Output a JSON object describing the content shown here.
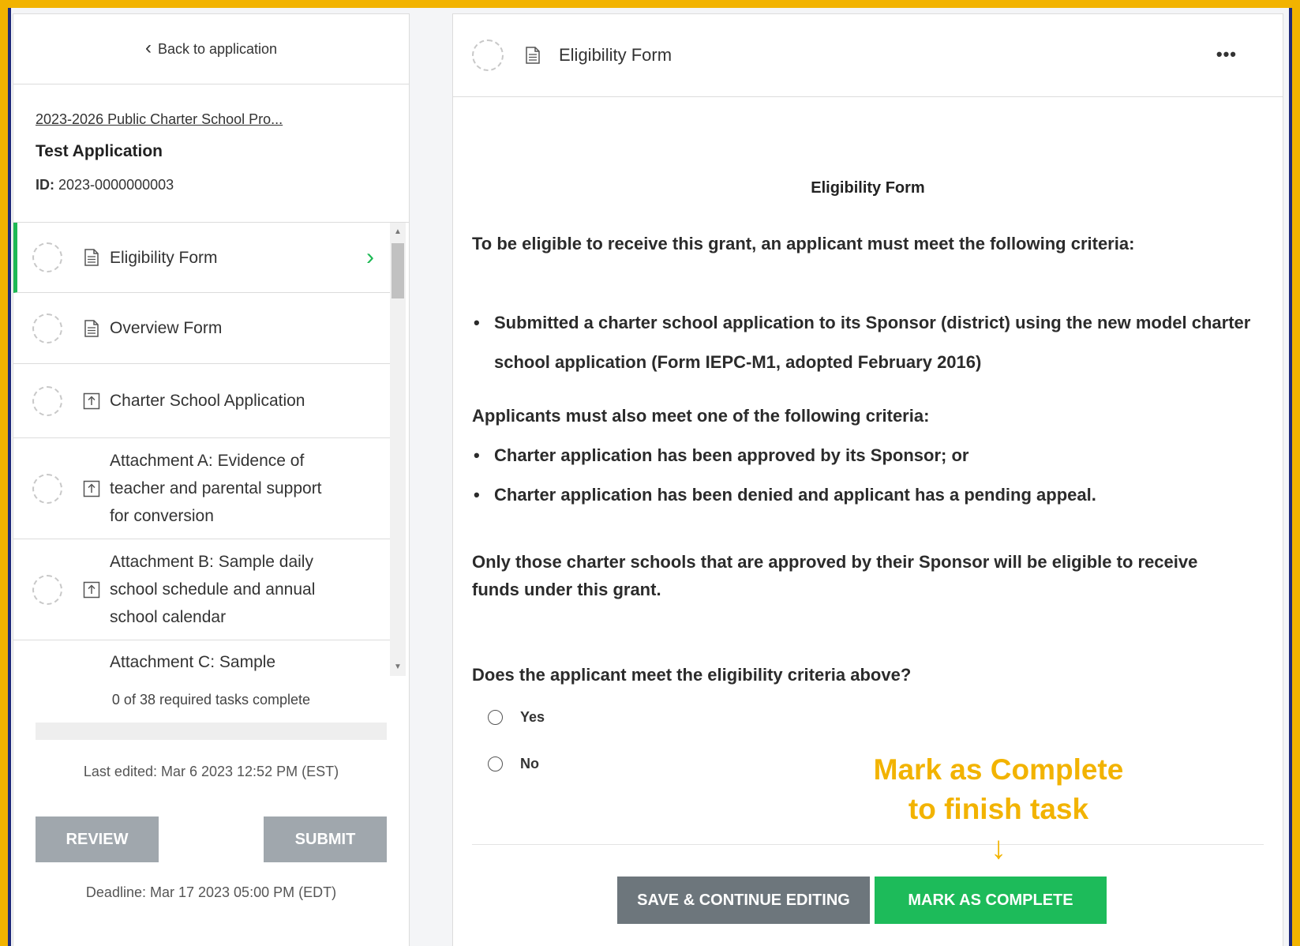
{
  "sidebar": {
    "back_label": "Back to application",
    "program_link": "2023-2026 Public Charter School Pro...",
    "application_title": "Test Application",
    "id_label": "ID:",
    "id_value": "2023-0000000003",
    "tasks": [
      {
        "label": "Eligibility Form",
        "icon": "document-icon",
        "active": true
      },
      {
        "label": "Overview Form",
        "icon": "document-icon",
        "active": false
      },
      {
        "label": "Charter School Application",
        "icon": "upload-icon",
        "active": false
      },
      {
        "label": "Attachment A: Evidence of teacher and parental support for conversion",
        "icon": "upload-icon",
        "active": false
      },
      {
        "label": "Attachment B: Sample daily school schedule and annual school calendar",
        "icon": "upload-icon",
        "active": false
      },
      {
        "label": "Attachment C: Sample",
        "icon": "upload-icon",
        "active": false
      }
    ],
    "tasks_complete": "0 of 38 required tasks complete",
    "progress_fraction": 0,
    "last_edited": "Last edited: Mar 6 2023 12:52 PM (EST)",
    "review_label": "REVIEW",
    "submit_label": "SUBMIT",
    "deadline": "Deadline: Mar 17 2023 05:00 PM (EDT)"
  },
  "main": {
    "header_title": "Eligibility Form",
    "more_label": "•••",
    "form_title": "Eligibility Form",
    "criteria_lead": "To be eligible to receive this grant, an applicant must meet the following criteria:",
    "criteria_1": "Submitted a charter school application to its Sponsor (district) using the new model charter school application (Form IEPC-M1, adopted February 2016)",
    "also_lead": "Applicants must also meet one of the following criteria:",
    "also_1": "Charter application has been approved by its Sponsor; or",
    "also_2": "Charter application has been denied and applicant has a pending appeal.",
    "only_text": "Only those charter schools that are approved by their Sponsor will be eligible to receive funds under this grant.",
    "question": "Does the applicant meet the eligibility criteria above?",
    "options": [
      "Yes",
      "No"
    ],
    "save_label": "SAVE & CONTINUE EDITING",
    "complete_label": "MARK AS COMPLETE"
  },
  "callout": {
    "line1": "Mark as Complete",
    "line2": "to finish task",
    "arrow": "↓"
  },
  "colors": {
    "accent_green": "#1db954",
    "callout_yellow": "#f2b300",
    "frame_blue": "#1f2a7a"
  }
}
